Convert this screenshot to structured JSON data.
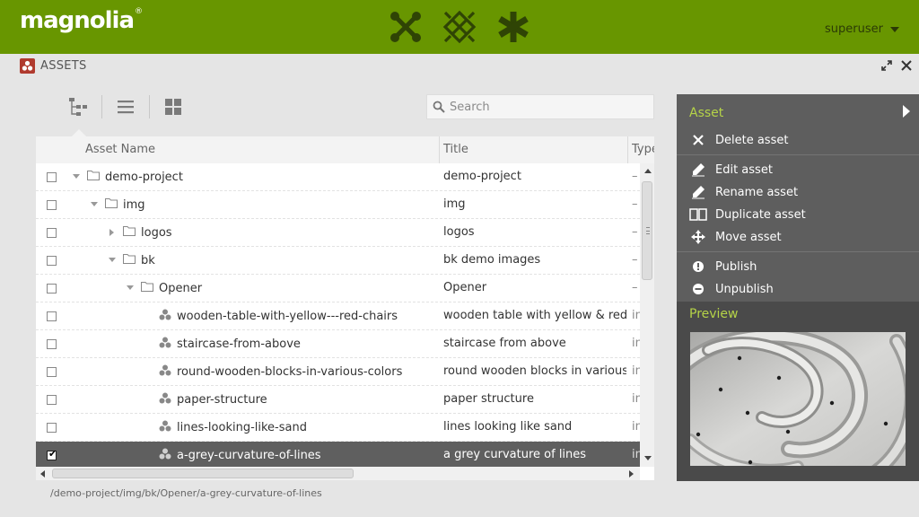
{
  "header": {
    "logo_text": "magnolia",
    "logo_mark": "®",
    "apps": [
      {
        "icon": "apps-cross-icon"
      },
      {
        "icon": "apps-grid-icon"
      },
      {
        "icon": "apps-asterisk-icon"
      }
    ],
    "user": "superuser",
    "colors": {
      "bar": "#689600",
      "user_text": "#2b3a06"
    }
  },
  "app": {
    "title": "ASSETS",
    "badge_color": "#b03a2e"
  },
  "toolbar": {
    "views": [
      "tree-view",
      "list-view",
      "thumbnail-view"
    ],
    "active_view": "tree-view",
    "search": {
      "placeholder": "Search",
      "value": ""
    }
  },
  "grid": {
    "columns": [
      "Asset Name",
      "Title",
      "Type"
    ],
    "rows": [
      {
        "name": "demo-project",
        "title": "demo-project",
        "type": "–",
        "kind": "folder",
        "depth": 0,
        "expanded": true,
        "checked": false
      },
      {
        "name": "img",
        "title": "img",
        "type": "–",
        "kind": "folder",
        "depth": 1,
        "expanded": true,
        "checked": false
      },
      {
        "name": "logos",
        "title": "logos",
        "type": "–",
        "kind": "folder",
        "depth": 2,
        "expanded": false,
        "checked": false
      },
      {
        "name": "bk",
        "title": "bk demo images",
        "type": "–",
        "kind": "folder",
        "depth": 2,
        "expanded": true,
        "checked": false
      },
      {
        "name": "Opener",
        "title": "Opener",
        "type": "–",
        "kind": "folder",
        "depth": 3,
        "expanded": true,
        "checked": false
      },
      {
        "name": "wooden-table-with-yellow---red-chairs",
        "title": "wooden table with yellow & red",
        "type": "in",
        "kind": "asset",
        "depth": 4,
        "checked": false
      },
      {
        "name": "staircase-from-above",
        "title": "staircase from above",
        "type": "in",
        "kind": "asset",
        "depth": 4,
        "checked": false
      },
      {
        "name": "round-wooden-blocks-in-various-colors",
        "title": "round wooden blocks in various",
        "type": "in",
        "kind": "asset",
        "depth": 4,
        "checked": false
      },
      {
        "name": "paper-structure",
        "title": "paper structure",
        "type": "in",
        "kind": "asset",
        "depth": 4,
        "checked": false
      },
      {
        "name": "lines-looking-like-sand",
        "title": "lines looking like sand",
        "type": "in",
        "kind": "asset",
        "depth": 4,
        "checked": false
      },
      {
        "name": "a-grey-curvature-of-lines",
        "title": "a grey curvature of lines",
        "type": "in",
        "kind": "asset",
        "depth": 4,
        "checked": true,
        "selected": true
      }
    ],
    "selected_color": "#5f5f5f"
  },
  "status": {
    "path": "/demo-project/img/bk/Opener/a-grey-curvature-of-lines"
  },
  "actionbar": {
    "section_title": "Asset",
    "actions": [
      {
        "label": "Delete asset",
        "icon": "delete-icon"
      },
      {
        "label": "Edit asset",
        "icon": "edit-icon"
      },
      {
        "label": "Rename asset",
        "icon": "rename-icon"
      },
      {
        "label": "Duplicate asset",
        "icon": "duplicate-icon"
      },
      {
        "label": "Move asset",
        "icon": "move-icon"
      },
      {
        "label": "Publish",
        "icon": "publish-icon"
      },
      {
        "label": "Unpublish",
        "icon": "unpublish-icon"
      }
    ],
    "preview_title": "Preview",
    "accent_color": "#b5d348"
  }
}
